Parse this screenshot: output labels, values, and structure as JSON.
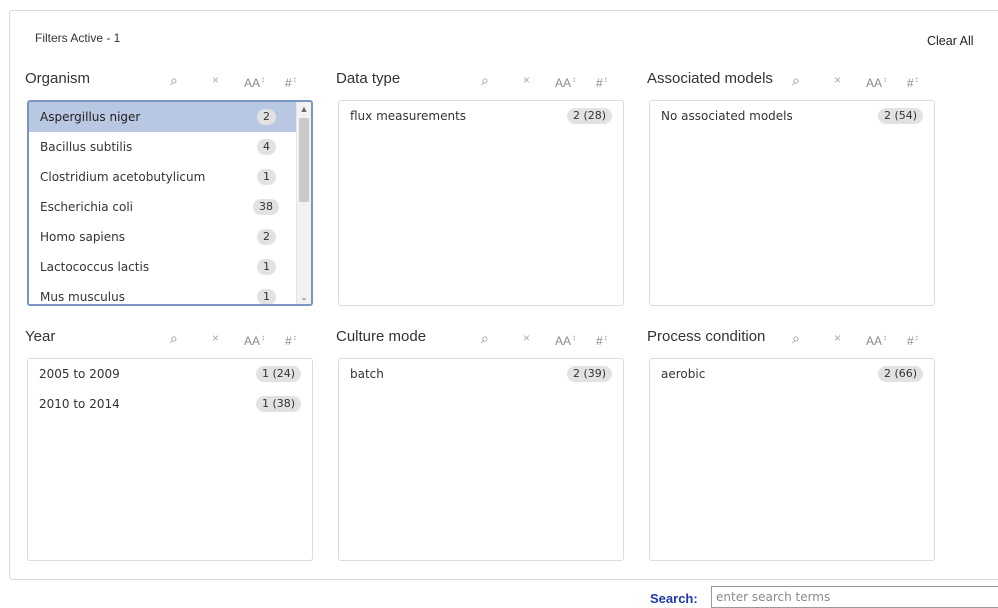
{
  "header": {
    "filters_active": "Filters Active - 1",
    "clear_all": "Clear All"
  },
  "controls": {
    "search_glyph": "⌕",
    "clear_glyph": "×",
    "sort_alpha_glyph": "AA",
    "sort_count_glyph": "#",
    "sort_marker": "↕"
  },
  "facets": {
    "organism": {
      "title": "Organism",
      "items": [
        {
          "label": "Aspergillus niger",
          "count": "2",
          "active": true
        },
        {
          "label": "Bacillus subtilis",
          "count": "4"
        },
        {
          "label": "Clostridium acetobutylicum",
          "count": "1"
        },
        {
          "label": "Escherichia coli",
          "count": "38"
        },
        {
          "label": "Homo sapiens",
          "count": "2"
        },
        {
          "label": "Lactococcus lactis",
          "count": "1"
        },
        {
          "label": "Mus musculus",
          "count": "1"
        }
      ]
    },
    "data_type": {
      "title": "Data type",
      "items": [
        {
          "label": "flux measurements",
          "count": "2 (28)"
        }
      ]
    },
    "associated_models": {
      "title": "Associated models",
      "items": [
        {
          "label": "No associated models",
          "count": "2 (54)"
        }
      ]
    },
    "year": {
      "title": "Year",
      "items": [
        {
          "label": "2005 to 2009",
          "count": "1 (24)"
        },
        {
          "label": "2010 to 2014",
          "count": "1 (38)"
        }
      ]
    },
    "culture_mode": {
      "title": "Culture mode",
      "items": [
        {
          "label": "batch",
          "count": "2 (39)"
        }
      ]
    },
    "process_condition": {
      "title": "Process condition",
      "items": [
        {
          "label": "aerobic",
          "count": "2 (66)"
        }
      ]
    }
  },
  "search": {
    "label": "Search:",
    "placeholder": "enter search terms"
  },
  "colors": {
    "active_row": "#b8c7e2",
    "selected_border": "#7a95c4",
    "search_label": "#1f3aa8"
  }
}
